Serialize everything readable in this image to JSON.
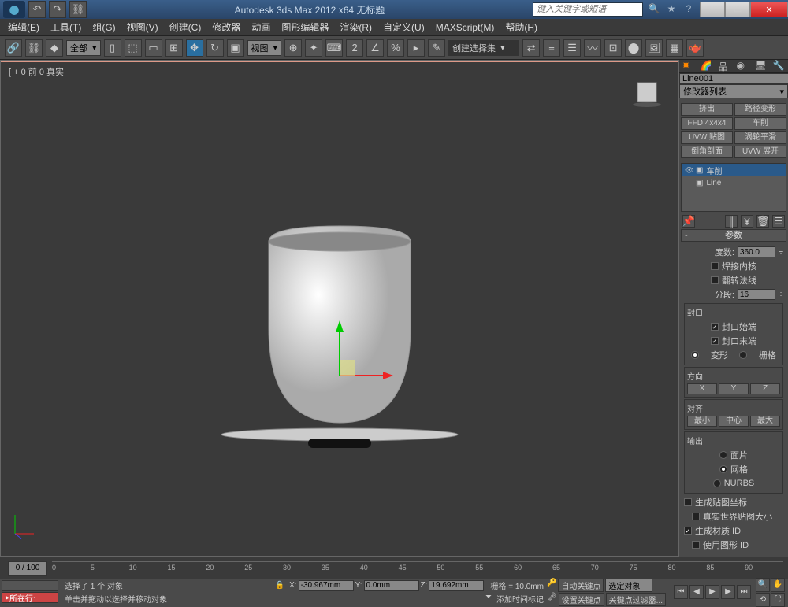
{
  "title": "Autodesk 3ds Max  2012 x64     无标题",
  "search_placeholder": "键入关键字或短语",
  "menus": [
    "编辑(E)",
    "工具(T)",
    "组(G)",
    "视图(V)",
    "创建(C)",
    "修改器",
    "动画",
    "图形编辑器",
    "渲染(R)",
    "自定义(U)",
    "MAXScript(M)",
    "帮助(H)"
  ],
  "tool_dd_all": "全部",
  "tool_dd_view": "视图",
  "tool_dd_create": "创建选择集",
  "viewport_label": "[ + 0 前 0 真实",
  "object_name": "Line001",
  "mod_list_label": "修改器列表",
  "mod_buttons": [
    "挤出",
    "路径变形",
    "FFD 4x4x4",
    "车削",
    "UVW 贴图",
    "涡轮平滑",
    "倒角剖面",
    "UVW 展开"
  ],
  "stack": [
    {
      "name": "车削",
      "sel": true
    },
    {
      "name": "Line",
      "sel": false
    }
  ],
  "params": {
    "title": "参数",
    "degrees_lbl": "度数:",
    "degrees": "360.0",
    "weld_lbl": "焊接内核",
    "flip_lbl": "翻转法线",
    "segments_lbl": "分段:",
    "segments": "16",
    "cap_grp": "封口",
    "cap_start": "封口始端",
    "cap_end": "封口末端",
    "morph": "变形",
    "grid": "栅格",
    "dir_grp": "方向",
    "align_grp": "对齐",
    "align_btns": [
      "最小",
      "中心",
      "最大"
    ],
    "output_grp": "输出",
    "out_patch": "面片",
    "out_mesh": "网格",
    "out_nurbs": "NURBS",
    "gen_uv": "生成贴图坐标",
    "real_world": "真实世界贴图大小",
    "gen_mat": "生成材质 ID",
    "use_shape": "使用图形 ID"
  },
  "slider": "0 / 100",
  "ticks": [
    "0",
    "5",
    "10",
    "15",
    "20",
    "25",
    "30",
    "35",
    "40",
    "45",
    "50",
    "55",
    "60",
    "65",
    "70",
    "75",
    "80",
    "85",
    "90"
  ],
  "location_tag": "所在行:",
  "status1": "选择了 1 个 对象",
  "status2": "单击并拖动以选择并移动对象",
  "coords": {
    "x": "-30.967mm",
    "y": "0.0mm",
    "z": "19.692mm",
    "grid": "栅格 = 10.0mm"
  },
  "auto_key": "自动关键点",
  "sel_obj": "选定对象",
  "set_key": "设置关键点",
  "key_filter": "关键点过滤器...",
  "add_time": "添加时间标记"
}
